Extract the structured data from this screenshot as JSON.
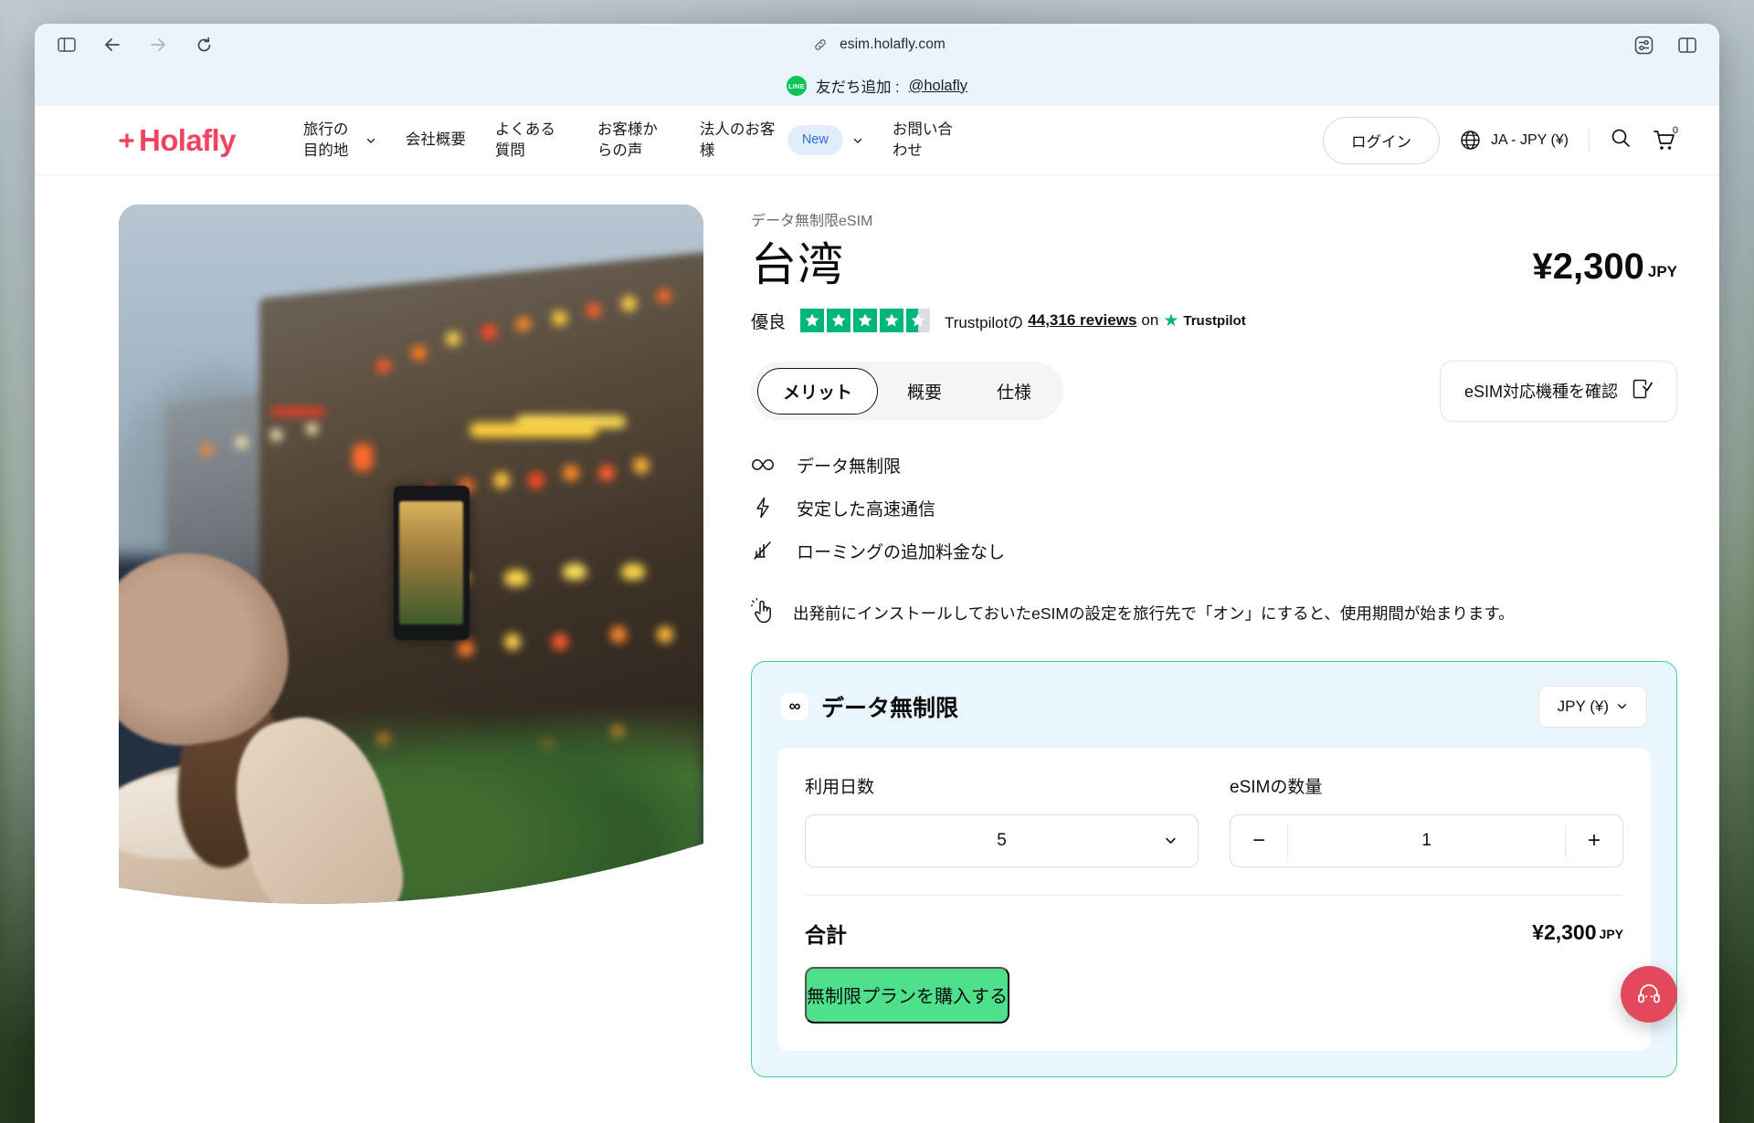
{
  "browser": {
    "url": "esim.holafly.com",
    "icons": {
      "sidebar": "sidebar-toggle-icon",
      "back": "back-arrow-icon",
      "forward": "forward-arrow-icon",
      "reload": "reload-icon",
      "link": "link-icon",
      "reader": "page-settings-icon",
      "tabs": "tab-overview-icon"
    }
  },
  "line_banner": {
    "icon_label": "LINE",
    "text": "友だち追加 : ",
    "handle": "@holafly"
  },
  "header": {
    "logo": "Holafly",
    "logo_color": "#f0445f",
    "nav": [
      {
        "label": "旅行の目的地",
        "has_chevron": true,
        "badge": null
      },
      {
        "label": "会社概要",
        "has_chevron": false,
        "badge": null
      },
      {
        "label": "よくある質問",
        "has_chevron": false,
        "badge": null
      },
      {
        "label": "お客様からの声",
        "has_chevron": false,
        "badge": null
      },
      {
        "label": "法人のお客様",
        "has_chevron": true,
        "badge": "New"
      },
      {
        "label": "お問い合わせ",
        "has_chevron": false,
        "badge": null
      }
    ],
    "login_label": "ログイン",
    "language": "JA - JPY (¥)",
    "cart_count": "0"
  },
  "product": {
    "eyebrow": "データ無制限eSIM",
    "destination": "台湾",
    "price": "¥2,300",
    "currency_suffix": "JPY"
  },
  "rating": {
    "label": "優良",
    "stars_total": 5,
    "stars_filled": 4,
    "has_half": true,
    "star_color": "#00b67a",
    "prefix": "Trustpilotの",
    "reviews": "44,316 reviews",
    "middle": " on ",
    "brand": "Trustpilot"
  },
  "tabs": [
    {
      "label": "メリット",
      "active": true
    },
    {
      "label": "概要",
      "active": false
    },
    {
      "label": "仕様",
      "active": false
    }
  ],
  "compat_button": {
    "label": "eSIM対応機種を確認",
    "icon": "phone-check-icon"
  },
  "features": [
    {
      "icon": "infinity-icon",
      "label": "データ無制限"
    },
    {
      "icon": "lightning-bolt-icon",
      "label": "安定した高速通信"
    },
    {
      "icon": "no-roaming-icon",
      "label": "ローミングの追加料金なし"
    }
  ],
  "note": {
    "icon": "tap-hand-icon",
    "text": "出発前にインストールしておいたeSIMの設定を旅行先で「オン」にすると、使用期間が始まります。"
  },
  "purchase_card": {
    "title": "データ無制限",
    "title_icon": "infinity-icon",
    "currency_selector": "JPY (¥)",
    "days_label": "利用日数",
    "days_value": "5",
    "quantity_label": "eSIMの数量",
    "quantity_value": "1",
    "decrement": "−",
    "increment": "+",
    "total_label": "合計",
    "total_value": "¥2,300",
    "total_currency": "JPY",
    "cta_label": "無制限プランを購入する",
    "cta_color": "#4ee08a",
    "border_color": "#3fd68c"
  },
  "support_fab": {
    "icon": "headset-support-icon",
    "color": "#e24a5c"
  }
}
